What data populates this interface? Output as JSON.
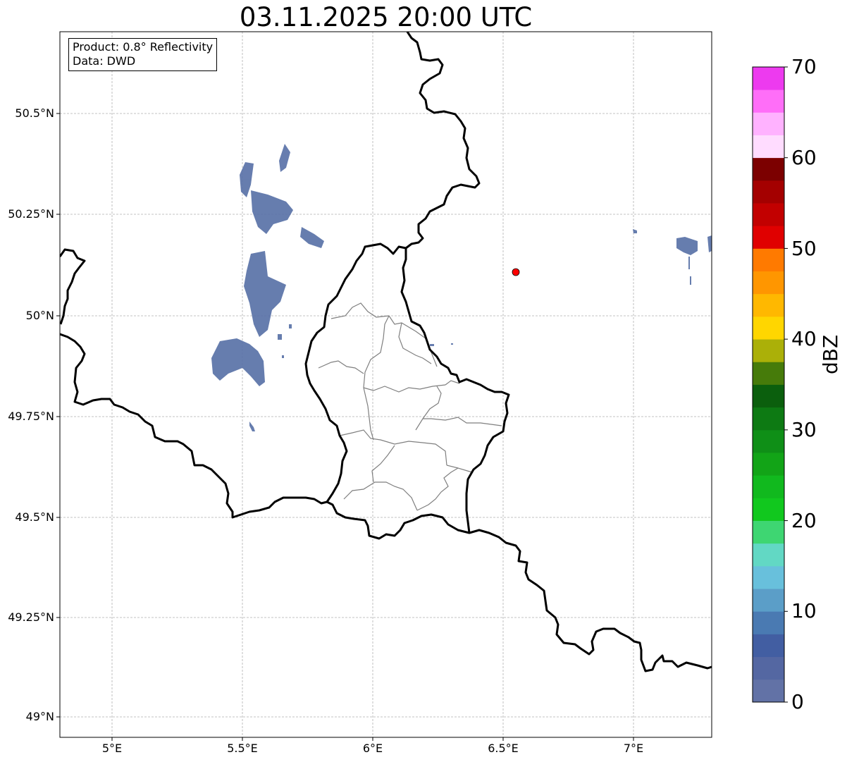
{
  "title": "03.11.2025 20:00 UTC",
  "info": {
    "product": "Product: 0.8° Reflectivity",
    "source": "Data: DWD"
  },
  "lat_ticks": [
    "50.5°N",
    "50.25°N",
    "50°N",
    "49.75°N",
    "49.5°N",
    "49.25°N",
    "49°N"
  ],
  "lon_ticks": [
    "5°E",
    "5.5°E",
    "6°E",
    "6.5°E",
    "7°E"
  ],
  "colorbar": {
    "label": "dBZ",
    "min": 0,
    "max": 70,
    "step": 2.5,
    "ticks": [
      "0",
      "10",
      "20",
      "30",
      "40",
      "50",
      "60",
      "70"
    ],
    "colors": [
      "#6272a6",
      "#5467a2",
      "#425ea2",
      "#4a7ab2",
      "#5b9ec8",
      "#68c0dc",
      "#62d8c4",
      "#3ed672",
      "#11c81e",
      "#11b91e",
      "#12a417",
      "#0f8f17",
      "#0d7a13",
      "#0b5f0d",
      "#467b0a",
      "#abb008",
      "#ffd600",
      "#ffb800",
      "#ff9600",
      "#ff7a00",
      "#e00000",
      "#c20000",
      "#a40000",
      "#7c0000",
      "#ffdcff",
      "#ffb2ff",
      "#ff6ef8",
      "#ed3aef"
    ]
  },
  "radar_site": {
    "name": "radar-site",
    "lon": 6.548,
    "lat": 50.11,
    "color": "#ff0000"
  },
  "echo_color": "#5a72a8"
}
